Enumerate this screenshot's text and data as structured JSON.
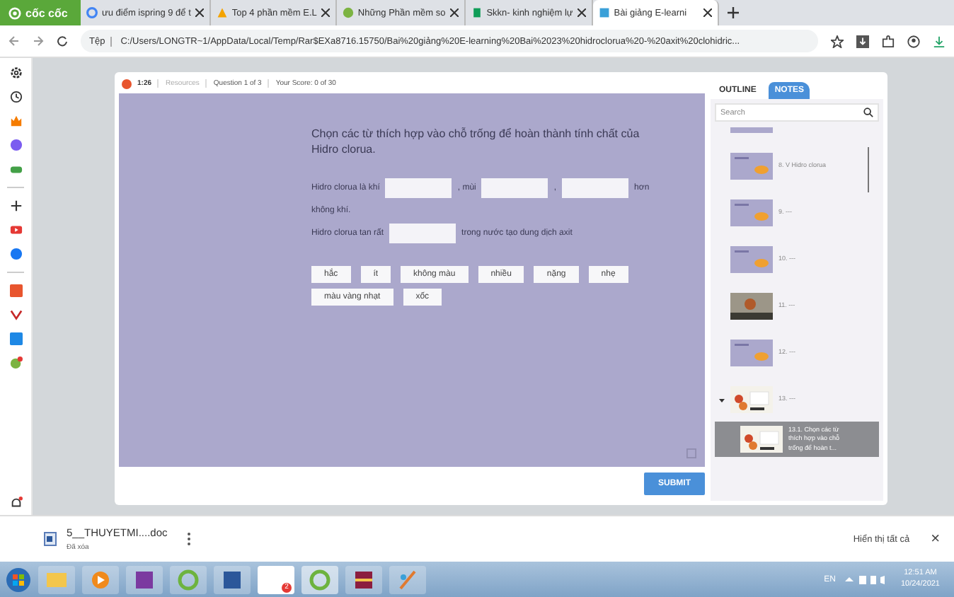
{
  "browser": {
    "logo": "cốc cốc",
    "tabs": [
      {
        "kind": "google",
        "title": "ưu điểm ispring 9 để t",
        "selected": false
      },
      {
        "kind": "drive",
        "title": "Top 4 phần mềm E.L",
        "selected": false
      },
      {
        "kind": "circle",
        "title": "Những Phần mềm so",
        "selected": false
      },
      {
        "kind": "bookmark",
        "title": "Skkn- kinh nghiệm lự",
        "selected": false
      },
      {
        "kind": "page",
        "title": "Bài giảng E-learni",
        "selected": true
      }
    ],
    "address": {
      "scheme": "Tệp",
      "url": "C:/Users/LONGTR~1/AppData/Local/Temp/Rar$EXa8716.15750/Bai%20giảng%20E-learning%20Bai%2023%20hidroclorua%20-%20axit%20clohidric..."
    }
  },
  "player": {
    "timer": "1:26",
    "resources": "Resources",
    "question": "Question 1 of 3",
    "score": "Your Score: 0 of 30",
    "prompt": "Chọn các từ thích hợp vào chỗ trống để hoàn thành tính chất của Hidro clorua.",
    "sentences": [
      [
        {
          "kind": "text",
          "text": "Hidro clorua là khí"
        },
        {
          "kind": "blank"
        },
        {
          "kind": "text",
          "text": ", mùi"
        },
        {
          "kind": "blank"
        },
        {
          "kind": "text",
          "text": ","
        },
        {
          "kind": "blank"
        },
        {
          "kind": "text",
          "text": "hơn"
        },
        {
          "kind": "text",
          "text": "không khí."
        }
      ],
      [
        {
          "kind": "text",
          "text": "Hidro clorua tan rất"
        },
        {
          "kind": "blank"
        },
        {
          "kind": "text",
          "text": "trong nước tạo dung dịch axit"
        }
      ]
    ],
    "words": [
      "hắc",
      "ít",
      "không màu",
      "nhiều",
      "nặng",
      "nhẹ",
      "màu vàng nhạt",
      "xốc"
    ],
    "submit": "SUBMIT"
  },
  "panel": {
    "tabs": [
      {
        "label": "OUTLINE",
        "selected": false
      },
      {
        "label": "NOTES",
        "selected": true
      }
    ],
    "search": {
      "placeholder": "Search"
    },
    "items": [
      {
        "kind": "slide",
        "expanded": false,
        "selected": false
      },
      {
        "kind": "slide",
        "label": "8. V Hidro clorua",
        "expanded": false,
        "selected": false
      },
      {
        "kind": "slide",
        "label": "9. ---",
        "expanded": false,
        "selected": false
      },
      {
        "kind": "slide",
        "label": "10. ---",
        "expanded": false,
        "selected": false
      },
      {
        "kind": "photo",
        "label": "11. ---",
        "expanded": false,
        "selected": false
      },
      {
        "kind": "slide",
        "label": "12. ---",
        "expanded": false,
        "selected": false
      },
      {
        "kind": "flowers",
        "label": "13. ---",
        "expanded": true,
        "selected": false
      },
      {
        "kind": "flowers",
        "label": "13.1. Chọn các từ thích hợp vào chỗ trống để hoàn t...",
        "expanded": false,
        "selected": true
      }
    ]
  },
  "download": {
    "file": "5__THUYETMI....doc",
    "status": "Đã xóa",
    "show_all": "Hiển thị tất cả",
    "close": "×"
  },
  "taskbar": {
    "zalo_badge": "2",
    "language": "EN",
    "time": "12:51 AM",
    "date": "10/24/2021"
  }
}
